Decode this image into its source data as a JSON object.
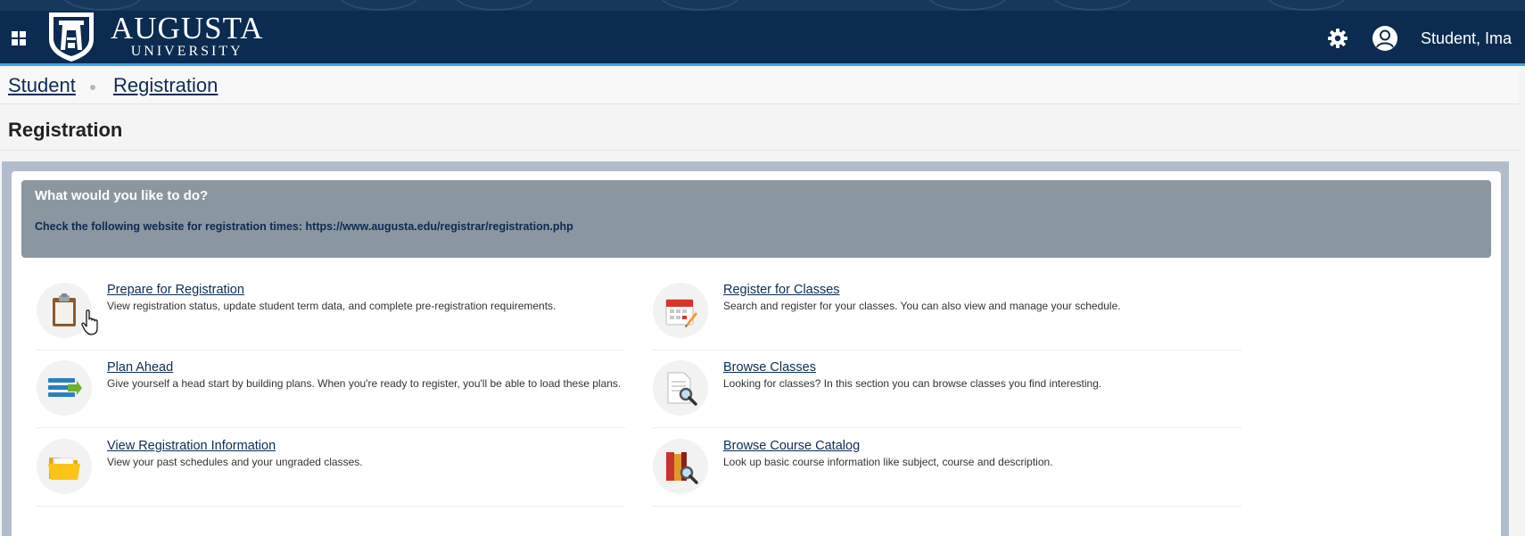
{
  "header": {
    "logo": {
      "name": "AUGUSTA",
      "subtitle": "UNIVERSITY"
    },
    "user_name": "Student, Ima"
  },
  "breadcrumb": {
    "items": [
      "Student",
      "Registration"
    ]
  },
  "page": {
    "title": "Registration"
  },
  "notice": {
    "title": "What would you like to do?",
    "text": "Check the following website for registration times: https://www.augusta.edu/registrar/registration.php"
  },
  "tasks": [
    {
      "label": "Prepare for Registration",
      "description": "View registration status, update student term data, and complete pre-registration requirements.",
      "icon": "clipboard-icon"
    },
    {
      "label": "Register for Classes",
      "description": "Search and register for your classes. You can also view and manage your schedule.",
      "icon": "calendar-icon"
    },
    {
      "label": "Plan Ahead",
      "description": "Give yourself a head start by building plans. When you're ready to register, you'll be able to load these plans.",
      "icon": "plan-list-icon"
    },
    {
      "label": "Browse Classes",
      "description": "Looking for classes? In this section you can browse classes you find interesting.",
      "icon": "document-search-icon"
    },
    {
      "label": "View Registration Information",
      "description": "View your past schedules and your ungraded classes.",
      "icon": "folder-icon"
    },
    {
      "label": "Browse Course Catalog",
      "description": "Look up basic course information like subject, course and description.",
      "icon": "book-search-icon"
    }
  ],
  "colors": {
    "header_bg": "#0b2b50",
    "accent": "#3aa6e0",
    "notice_bg": "#8a97a1",
    "link": "#0c2d52"
  }
}
